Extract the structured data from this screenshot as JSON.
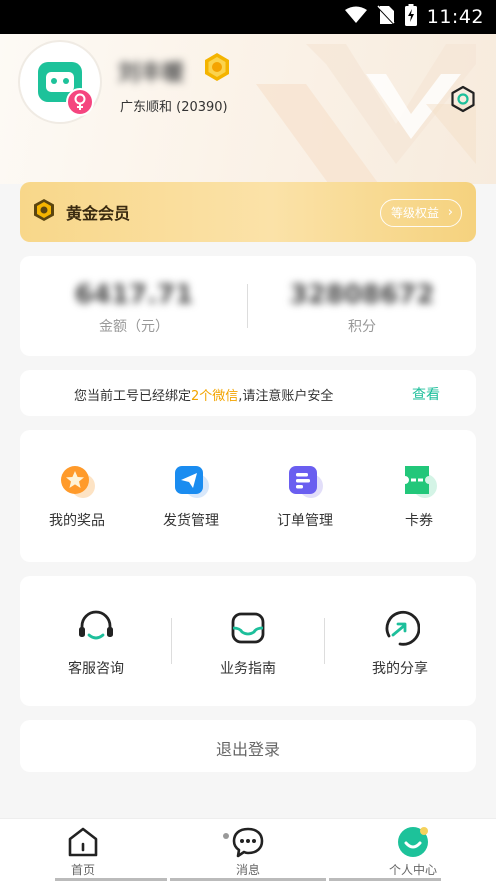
{
  "status_bar": {
    "time": "11:42"
  },
  "profile": {
    "name": "刘丰暖",
    "company": "广东顺和 (20390)"
  },
  "vip": {
    "label": "黄金会员",
    "rights_button": "等级权益"
  },
  "balance": {
    "amount_value": "6417.71",
    "amount_label": "金额（元）",
    "points_value": "32808672",
    "points_label": "积分"
  },
  "notice": {
    "text_before": "您当前工号已经绑定",
    "highlight": "2个微信",
    "text_after": ",请注意账户安全",
    "link": "查看"
  },
  "services": [
    {
      "label": "我的奖品",
      "icon": "prize-icon"
    },
    {
      "label": "发货管理",
      "icon": "send-icon"
    },
    {
      "label": "订单管理",
      "icon": "order-icon"
    },
    {
      "label": "卡券",
      "icon": "coupon-icon"
    }
  ],
  "support": [
    {
      "label": "客服咨询",
      "icon": "headset-icon"
    },
    {
      "label": "业务指南",
      "icon": "guide-icon"
    },
    {
      "label": "我的分享",
      "icon": "share-icon"
    }
  ],
  "logout": {
    "label": "退出登录"
  },
  "tabs": [
    {
      "label": "首页",
      "icon": "home-icon"
    },
    {
      "label": "消息",
      "icon": "message-icon"
    },
    {
      "label": "个人中心",
      "icon": "profile-icon",
      "active": true
    }
  ],
  "colors": {
    "accent": "#1dbf9b",
    "highlight": "#f2a400",
    "vip_gold": "#f8d78a"
  }
}
